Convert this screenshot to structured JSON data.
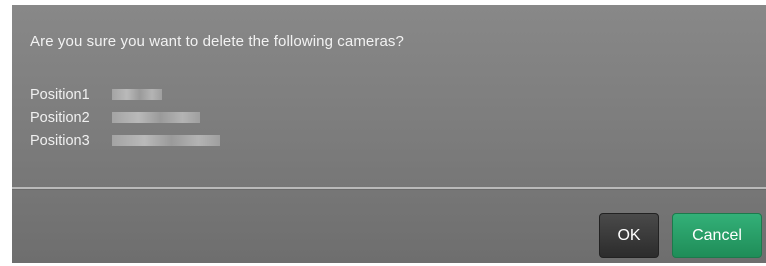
{
  "dialog": {
    "message": "Are you sure you want to delete the following cameras?",
    "cameras": [
      {
        "name": "Position1"
      },
      {
        "name": "Position2"
      },
      {
        "name": "Position3"
      }
    ],
    "buttons": {
      "ok_label": "OK",
      "cancel_label": "Cancel"
    }
  },
  "colors": {
    "dialog_background": "#7f7f7f",
    "ok_button": "#333333",
    "cancel_button": "#27a066",
    "text": "#f2f2f2"
  }
}
